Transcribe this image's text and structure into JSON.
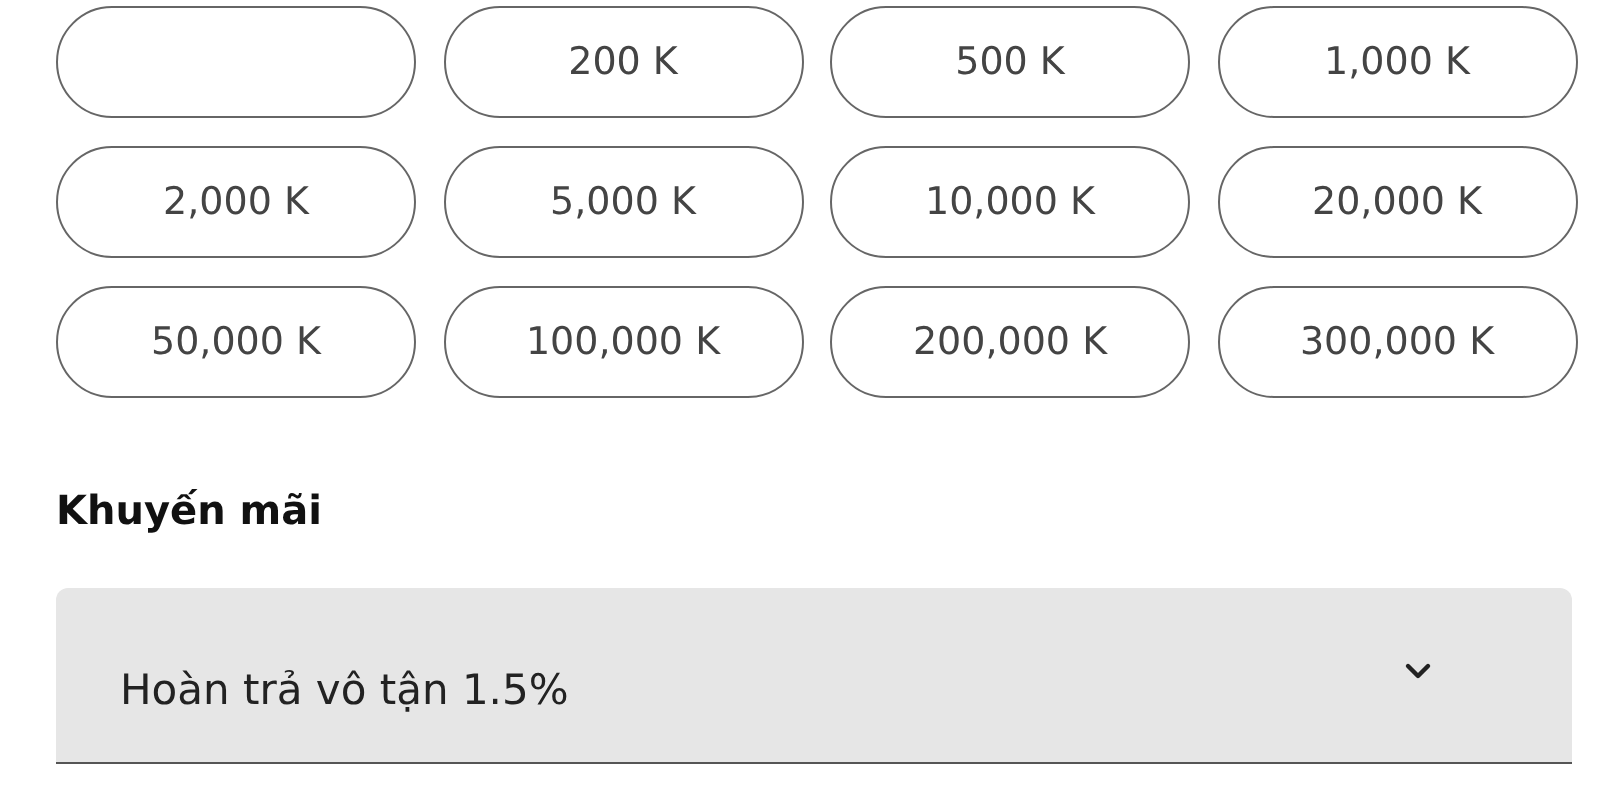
{
  "amounts": [
    {
      "kind": "blank"
    },
    {
      "kind": "amount",
      "label": "200 K"
    },
    {
      "kind": "amount",
      "label": "500 K"
    },
    {
      "kind": "amount",
      "label": "1,000 K"
    },
    {
      "kind": "amount",
      "label": "2,000 K"
    },
    {
      "kind": "amount",
      "label": "5,000 K"
    },
    {
      "kind": "amount",
      "label": "10,000 K"
    },
    {
      "kind": "amount",
      "label": "20,000 K"
    },
    {
      "kind": "amount",
      "label": "50,000 K"
    },
    {
      "kind": "amount",
      "label": "100,000 K"
    },
    {
      "kind": "amount",
      "label": "200,000 K"
    },
    {
      "kind": "amount",
      "label": "300,000 K"
    }
  ],
  "promotion": {
    "label": "Khuyến mãi",
    "value": "Hoàn trả vô tận 1.5%"
  }
}
